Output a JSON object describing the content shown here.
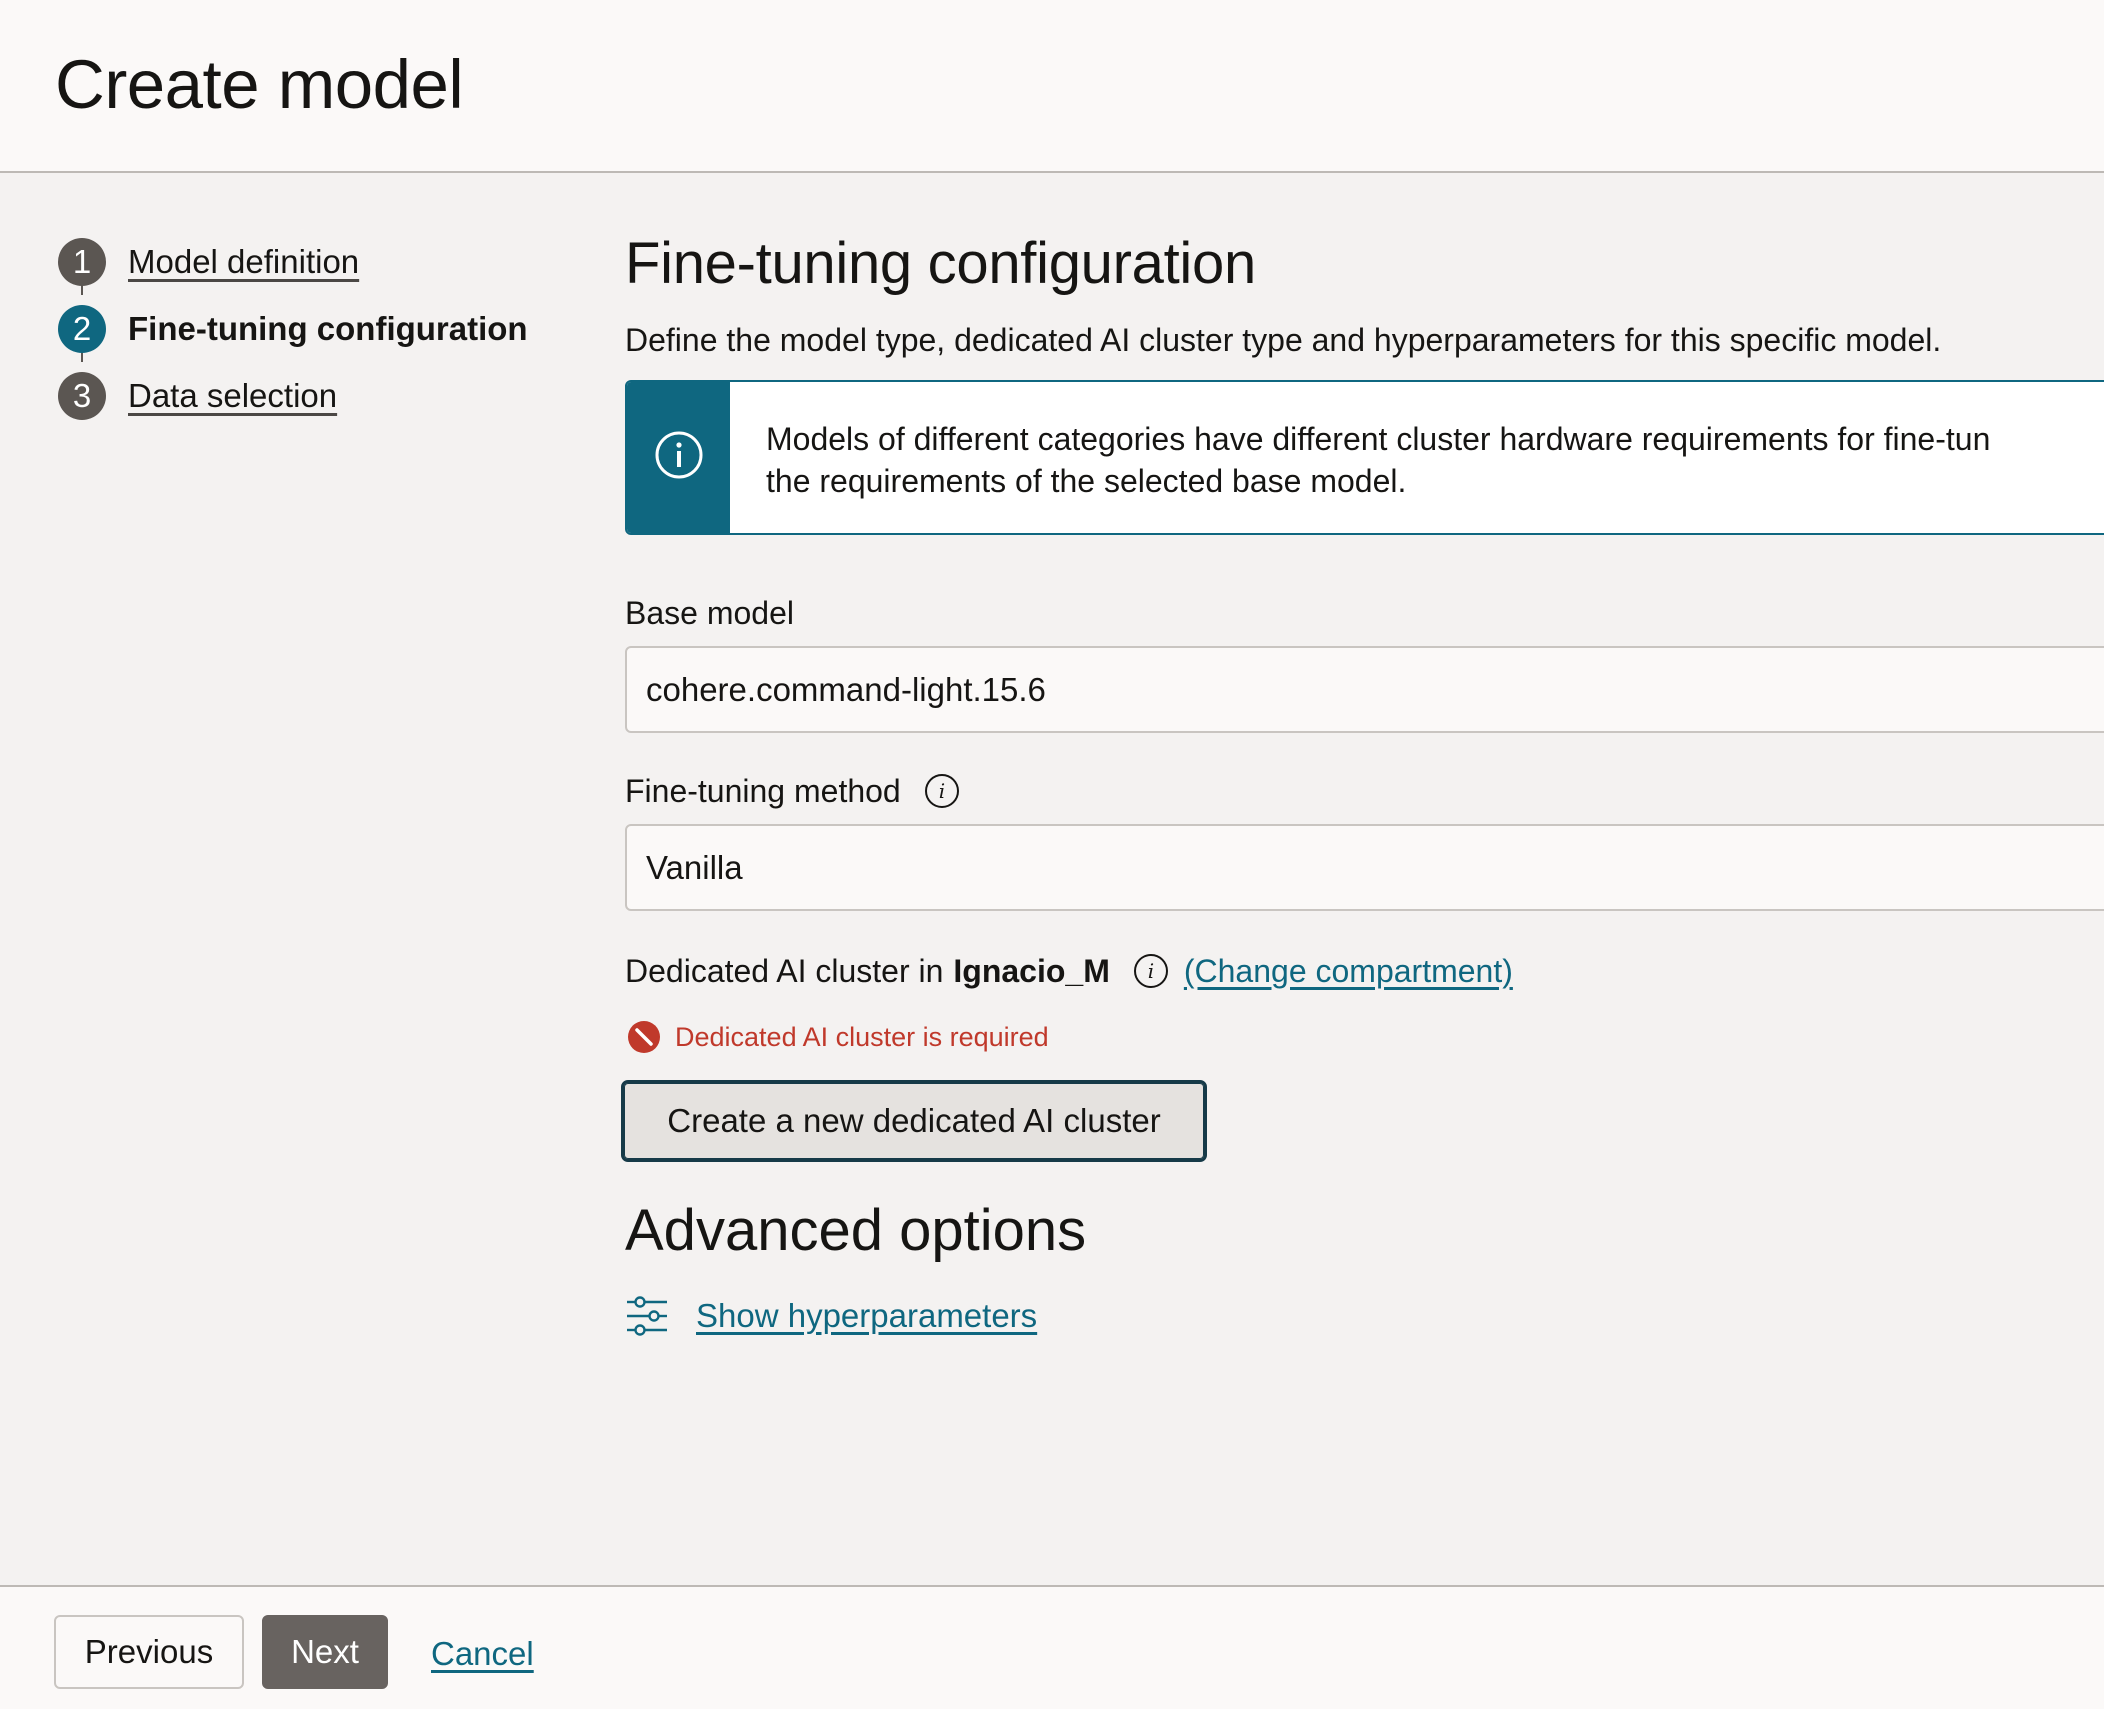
{
  "header": {
    "title": "Create model"
  },
  "stepper": {
    "steps": [
      {
        "number": "1",
        "label": "Model definition"
      },
      {
        "number": "2",
        "label": "Fine-tuning configuration"
      },
      {
        "number": "3",
        "label": "Data selection"
      }
    ],
    "active_step": 2
  },
  "main": {
    "title": "Fine-tuning configuration",
    "description": "Define the model type, dedicated AI cluster type and hyperparameters for this specific model.",
    "info": {
      "line1": "Models of different categories have different cluster hardware requirements for fine-tun",
      "line2": "the requirements of the selected base model."
    },
    "base_model": {
      "label": "Base model",
      "value": "cohere.command-light.15.6"
    },
    "method": {
      "label": "Fine-tuning method",
      "value": "Vanilla"
    },
    "cluster": {
      "label_prefix": "Dedicated AI cluster in",
      "compartment": "Ignacio_M",
      "change_link": "(Change compartment)",
      "error": "Dedicated AI cluster is required",
      "create_button": "Create a new dedicated AI cluster"
    },
    "advanced": {
      "title": "Advanced options",
      "hyper_link": "Show hyperparameters"
    }
  },
  "footer": {
    "previous": "Previous",
    "next": "Next",
    "cancel": "Cancel"
  },
  "colors": {
    "accent": "#0f6780",
    "error": "#c0392b",
    "step_inactive": "#5b5652",
    "next_button": "#686360"
  }
}
